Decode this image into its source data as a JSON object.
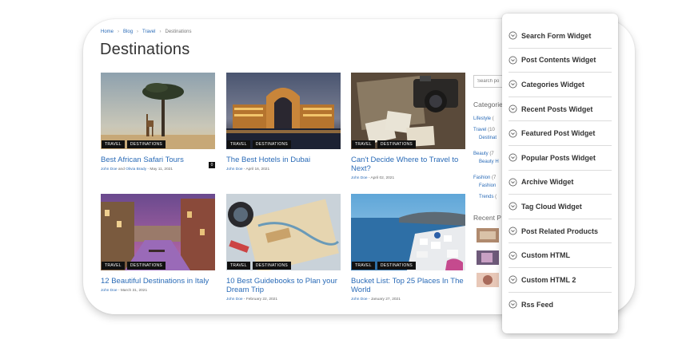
{
  "breadcrumb": {
    "home": "Home",
    "blog": "Blog",
    "travel": "Travel",
    "current": "Destinations"
  },
  "page_title": "Destinations",
  "posts": [
    {
      "title": "Best African Safari Tours",
      "tags": [
        "TRAVEL",
        "DESTINATIONS"
      ],
      "author": "John Doe",
      "conj": "and",
      "author2": "Olivia Brady",
      "date": "May 11, 2021",
      "comments": "0"
    },
    {
      "title": "The Best Hotels in Dubai",
      "tags": [
        "TRAVEL",
        "DESTINATIONS"
      ],
      "author": "John Doe",
      "date": "April 16, 2021"
    },
    {
      "title": "Can't Decide Where to Travel to Next?",
      "tags": [
        "TRAVEL",
        "DESTINATIONS"
      ],
      "author": "John Doe",
      "date": "April 02, 2021"
    },
    {
      "title": "12 Beautiful Destinations in Italy",
      "tags": [
        "TRAVEL",
        "DESTINATIONS"
      ],
      "author": "John Doe",
      "date": "March 31, 2021"
    },
    {
      "title": "10 Best Guidebooks to Plan your Dream Trip",
      "tags": [
        "TRAVEL",
        "DESTINATIONS"
      ],
      "author": "John Doe",
      "date": "February 22, 2021"
    },
    {
      "title": "Bucket List: Top 25 Places In The World",
      "tags": [
        "TRAVEL",
        "DESTINATIONS"
      ],
      "author": "John Doe",
      "date": "January 27, 2021"
    }
  ],
  "meta_sep": " - ",
  "sidebar": {
    "search_placeholder": "Search po",
    "categories_heading": "Categorie",
    "categories": [
      {
        "label": "Lifestyle",
        "count": "(",
        "sub": false
      },
      {
        "label": "Travel",
        "count": "(10",
        "sub": false
      },
      {
        "label": "Destinat",
        "count": "",
        "sub": true
      },
      {
        "label": "Beauty",
        "count": "(7",
        "sub": false
      },
      {
        "label": "Beauty H",
        "count": "",
        "sub": true
      },
      {
        "label": "Fashion",
        "count": "(7",
        "sub": false
      },
      {
        "label": "Fashion",
        "count": "",
        "sub": true
      },
      {
        "label": "Trends",
        "count": "(",
        "sub": true
      }
    ],
    "recent_heading": "Recent P"
  },
  "widgets": [
    "Search Form Widget",
    "Post Contents Widget",
    "Categories Widget",
    "Recent Posts Widget",
    "Featured Post Widget",
    "Popular Posts Widget",
    "Archive Widget",
    "Tag Cloud Widget",
    "Post Related Products",
    "Custom HTML",
    "Custom HTML 2",
    "Rss Feed"
  ],
  "widget_icon": "circle-chevron-down-icon",
  "colors": {
    "link": "#2a6bb7",
    "tag_bg": "#111111",
    "title": "#333333"
  }
}
